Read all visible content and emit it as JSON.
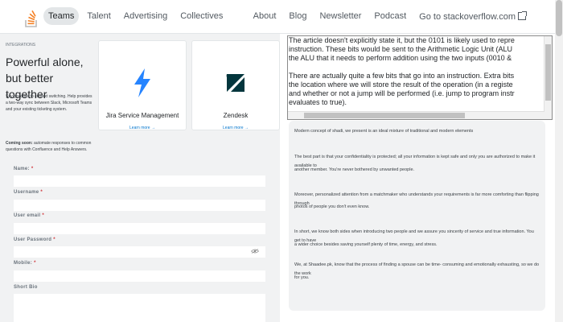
{
  "nav": {
    "left_items": [
      "Teams",
      "Talent",
      "Advertising",
      "Collectives"
    ],
    "right_items": [
      "About",
      "Blog",
      "Newsletter",
      "Podcast"
    ],
    "external_link": "Go to stackoverflow.com"
  },
  "promo": {
    "pre_text": "INTEGRATIONS",
    "title": "Powerful alone, but better together",
    "description": "Say goodbye to context switching. Help provides a two-way sync between Slack, Microsoft Teams and your existing ticketing system.",
    "soon_label": "Coming soon:",
    "soon_text": " automate responses to common questions with Confluence and Help Answers.",
    "cards": [
      {
        "title": "Jira Service Management",
        "link": "Learn more →"
      },
      {
        "title": "Zendesk",
        "link": "Learn more →"
      }
    ]
  },
  "form": {
    "name_label": "Name:",
    "username_label": "Username",
    "email_label": "User email",
    "password_label": "User Password",
    "mobile_label": "Mobile:",
    "bio_label": "Short Bio",
    "required_mark": "*"
  },
  "textbox": {
    "line1": "The article doesn't explicitly state it, but the 0101 is likely used to repre",
    "line2": "instruction. These bits would be sent to the Arithmetic Logic Unit (ALU",
    "line3": "the ALU that it needs to perform addition using the two inputs (0010 &",
    "line4": "There are actually quite a few bits that go into an instruction. Extra bits",
    "line5": "the location where we will store the result of the operation (in a registe",
    "line6": "and whether or not a jump will be performed (i.e. jump to program instr",
    "line7": "evaluates to true)."
  },
  "article": {
    "p1": "Modern concept of shadi, we present is an ideal mixture of traditional and modern elements",
    "p2a": "The best part is that your confidentiality is protected; all your information is kept safe and only you are authorized to make it available to",
    "p2b": "another member. You're never bothered by unwanted people.",
    "p3a": "Moreover, personalized attention from a matchmaker who understands your requirements is far more comforting than flipping through",
    "p3b": "photos of people you don't even know.",
    "p4a": "In short, we know both sides when introducing two people and we assure you sincerity of service and true information. You get to have",
    "p4b": "a wider choice besides saving yourself plenty of time, energy, and stress.",
    "p5a": "We, at Shaadee.pk, know that the process of finding a spouse can be time- consuming and emotionally exhausting, so we do the work",
    "p5b": "for you."
  },
  "colors": {
    "accent": "#f48024",
    "jira_blue": "#2684ff",
    "zendesk_green": "#03363d",
    "link_blue": "#0074cc"
  },
  "icons": [
    "stackoverflow-logo-icon",
    "external-link-icon",
    "jira-icon",
    "zendesk-icon",
    "eye-icon"
  ]
}
